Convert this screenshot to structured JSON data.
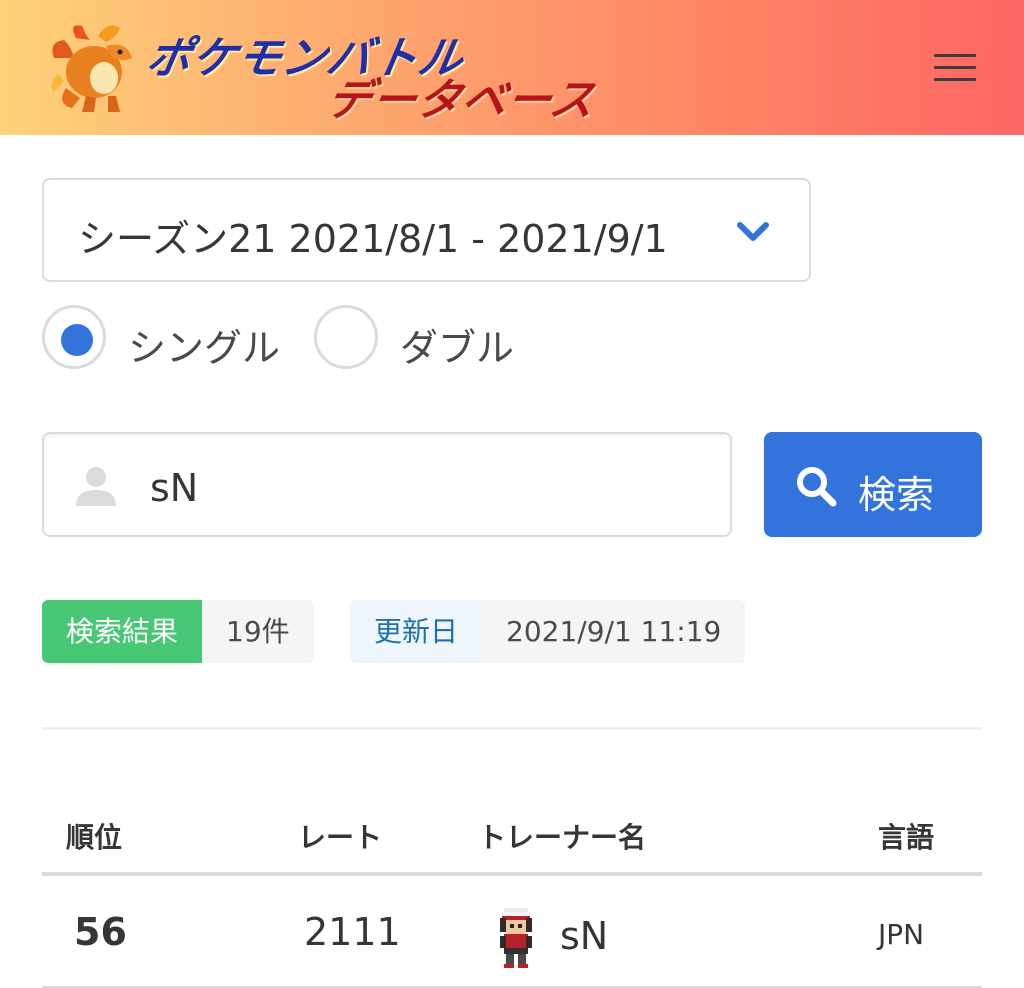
{
  "header": {
    "logo_line1": "ポケモンバトル",
    "logo_line2": "データベース",
    "menu_icon": "hamburger-menu-icon",
    "mascot_icon": "charizard-mascot-icon"
  },
  "season_select": {
    "value": "シーズン21  2021/8/1 - 2021/9/1",
    "arrow_icon": "chevron-down-icon"
  },
  "battle_format": {
    "options": [
      {
        "label": "シングル",
        "selected": true
      },
      {
        "label": "ダブル",
        "selected": false
      }
    ]
  },
  "search": {
    "value": "sN",
    "icon": "user-icon",
    "button_label": "検索",
    "button_icon": "search-icon"
  },
  "result_tags": {
    "count_label": "検索結果",
    "count_value": "19件",
    "updated_label": "更新日",
    "updated_value": "2021/9/1 11:19"
  },
  "table": {
    "columns": [
      "順位",
      "レート",
      "トレーナー名",
      "言語"
    ],
    "rows": [
      {
        "rank": "56",
        "rate": "2111",
        "trainer": "sN",
        "language": "JPN",
        "avatar_icon": "trainer-sprite-icon"
      }
    ]
  },
  "colors": {
    "primary": "#3273dc",
    "success": "#48c774",
    "info_bg": "#eef6fc",
    "info_text": "#1d72aa",
    "header_gradient_start": "#fdd27a",
    "header_gradient_end": "#ff6664"
  }
}
